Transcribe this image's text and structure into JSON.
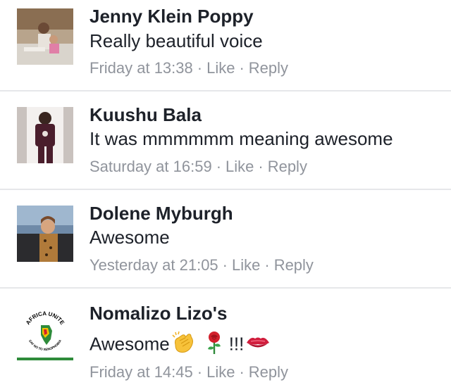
{
  "comments": [
    {
      "author": "Jenny Klein Poppy",
      "text": "Really beautiful voice",
      "time": "Friday at 13:38",
      "like": "Like",
      "reply": "Reply",
      "sep": "·"
    },
    {
      "author": "Kuushu Bala",
      "text": "It was mmmmmm meaning awesome",
      "time": "Saturday at 16:59",
      "like": "Like",
      "reply": "Reply",
      "sep": "·"
    },
    {
      "author": "Dolene Myburgh",
      "text": "Awesome",
      "time": "Yesterday at 21:05",
      "like": "Like",
      "reply": "Reply",
      "sep": "·"
    },
    {
      "author": "Nomalizo Lizo's",
      "text": "Awesome",
      "emoji_text": "!!!",
      "time": "Friday at 14:45",
      "like": "Like",
      "reply": "Reply",
      "sep": "·",
      "avatar_logo": {
        "top": "AFRICA UNITE",
        "bottom": "SAY NO TO XENOPHOBIA"
      }
    }
  ],
  "icons": [
    "clapping-hands-icon",
    "rose-icon",
    "kiss-mark-icon"
  ],
  "colors": {
    "name": "#1d2129",
    "meta": "#90949c",
    "divider": "#e6e7ea"
  }
}
